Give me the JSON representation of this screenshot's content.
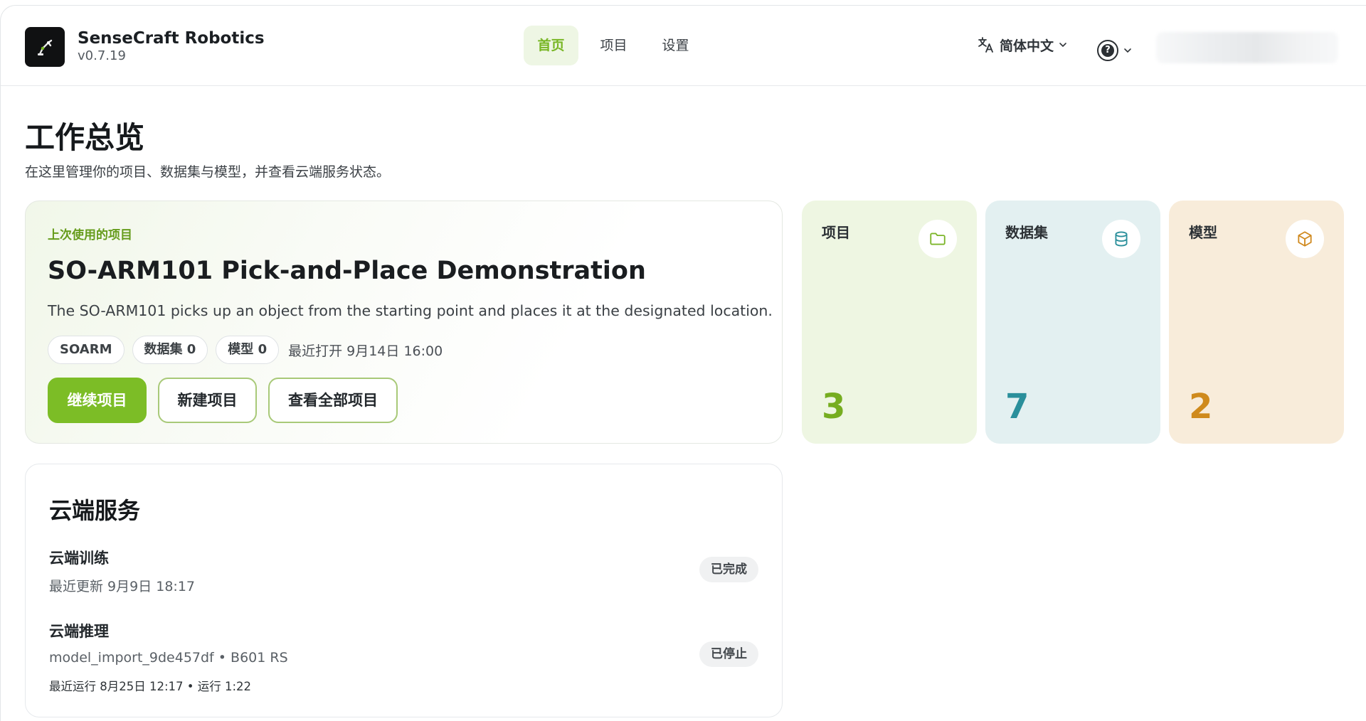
{
  "app": {
    "name": "SenseCraft Robotics",
    "version": "v0.7.19"
  },
  "nav": {
    "items": [
      {
        "label": "首页",
        "active": true
      },
      {
        "label": "项目"
      },
      {
        "label": "设置"
      }
    ]
  },
  "header": {
    "language": "简体中文"
  },
  "page": {
    "title": "工作总览",
    "subtitle": "在这里管理你的项目、数据集与模型，并查看云端服务状态。"
  },
  "recent": {
    "label": "上次使用的项目",
    "title": "SO-ARM101 Pick-and-Place Demonstration",
    "description": "The SO-ARM101 picks up an object from the starting point and places it at the designated location.",
    "chips": [
      "SOARM",
      "数据集 0",
      "模型 0"
    ],
    "last_opened": "最近打开 9月14日 16:00",
    "buttons": {
      "continue": "继续项目",
      "new": "新建项目",
      "view_all": "查看全部项目"
    }
  },
  "stats": [
    {
      "label": "项目",
      "value": "3",
      "icon": "folder-icon",
      "bg": "#eef6e2",
      "color": "#76ad20",
      "icon_color": "#7cb52a"
    },
    {
      "label": "数据集",
      "value": "7",
      "icon": "database-icon",
      "bg": "#e3f0f1",
      "color": "#2a8f9b",
      "icon_color": "#2a8f9b"
    },
    {
      "label": "模型",
      "value": "2",
      "icon": "cube-icon",
      "bg": "#f8ecda",
      "color": "#cf8a1c",
      "icon_color": "#d08a20"
    }
  ],
  "cloud": {
    "title": "云端服务",
    "training": {
      "name": "云端训练",
      "updated": "最近更新 9月9日 18:17",
      "status": "已完成"
    },
    "inference": {
      "name": "云端推理",
      "model_line": "model_import_9de457df • B601 RS",
      "run_line": "最近运行 8月25日 12:17 • 运行 1:22",
      "status": "已停止"
    }
  }
}
